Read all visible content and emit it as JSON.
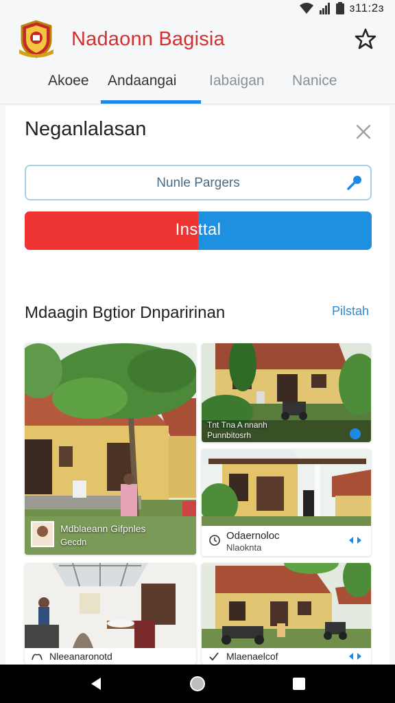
{
  "status": {
    "time": "ɜ11:2ɜ"
  },
  "header": {
    "title": "Nadaonn Bagisia",
    "tabs": [
      {
        "label": "Akoee",
        "active": false
      },
      {
        "label": "Andaangai",
        "active": true
      },
      {
        "label": "Iabaigan",
        "active": false
      },
      {
        "label": "Nanice",
        "active": false
      }
    ]
  },
  "sheet": {
    "title": "Neganlalasan",
    "search": {
      "value": "Nunle Pargers"
    },
    "install_label": "Insttal",
    "section_title": "Mdaagin Bgtior Dnparirinan",
    "section_link": "Pilstah"
  },
  "cards": [
    {
      "title": "Mdblaeann Gifpnles",
      "subtitle": "Gecdn"
    },
    {
      "overlay1": "Tnt Tna A nnanh",
      "overlay2": "Punnbitosrh"
    },
    {
      "title": "Odaernoloc",
      "subtitle": "Nlaoknta"
    },
    {
      "title": "Nleeanaronotd"
    },
    {
      "title": "Mlaenaelcof"
    }
  ],
  "colors": {
    "brand_red": "#d32f2f",
    "accent_blue": "#1e88e5",
    "install_red": "#ee3333",
    "install_blue": "#1f90e0"
  }
}
